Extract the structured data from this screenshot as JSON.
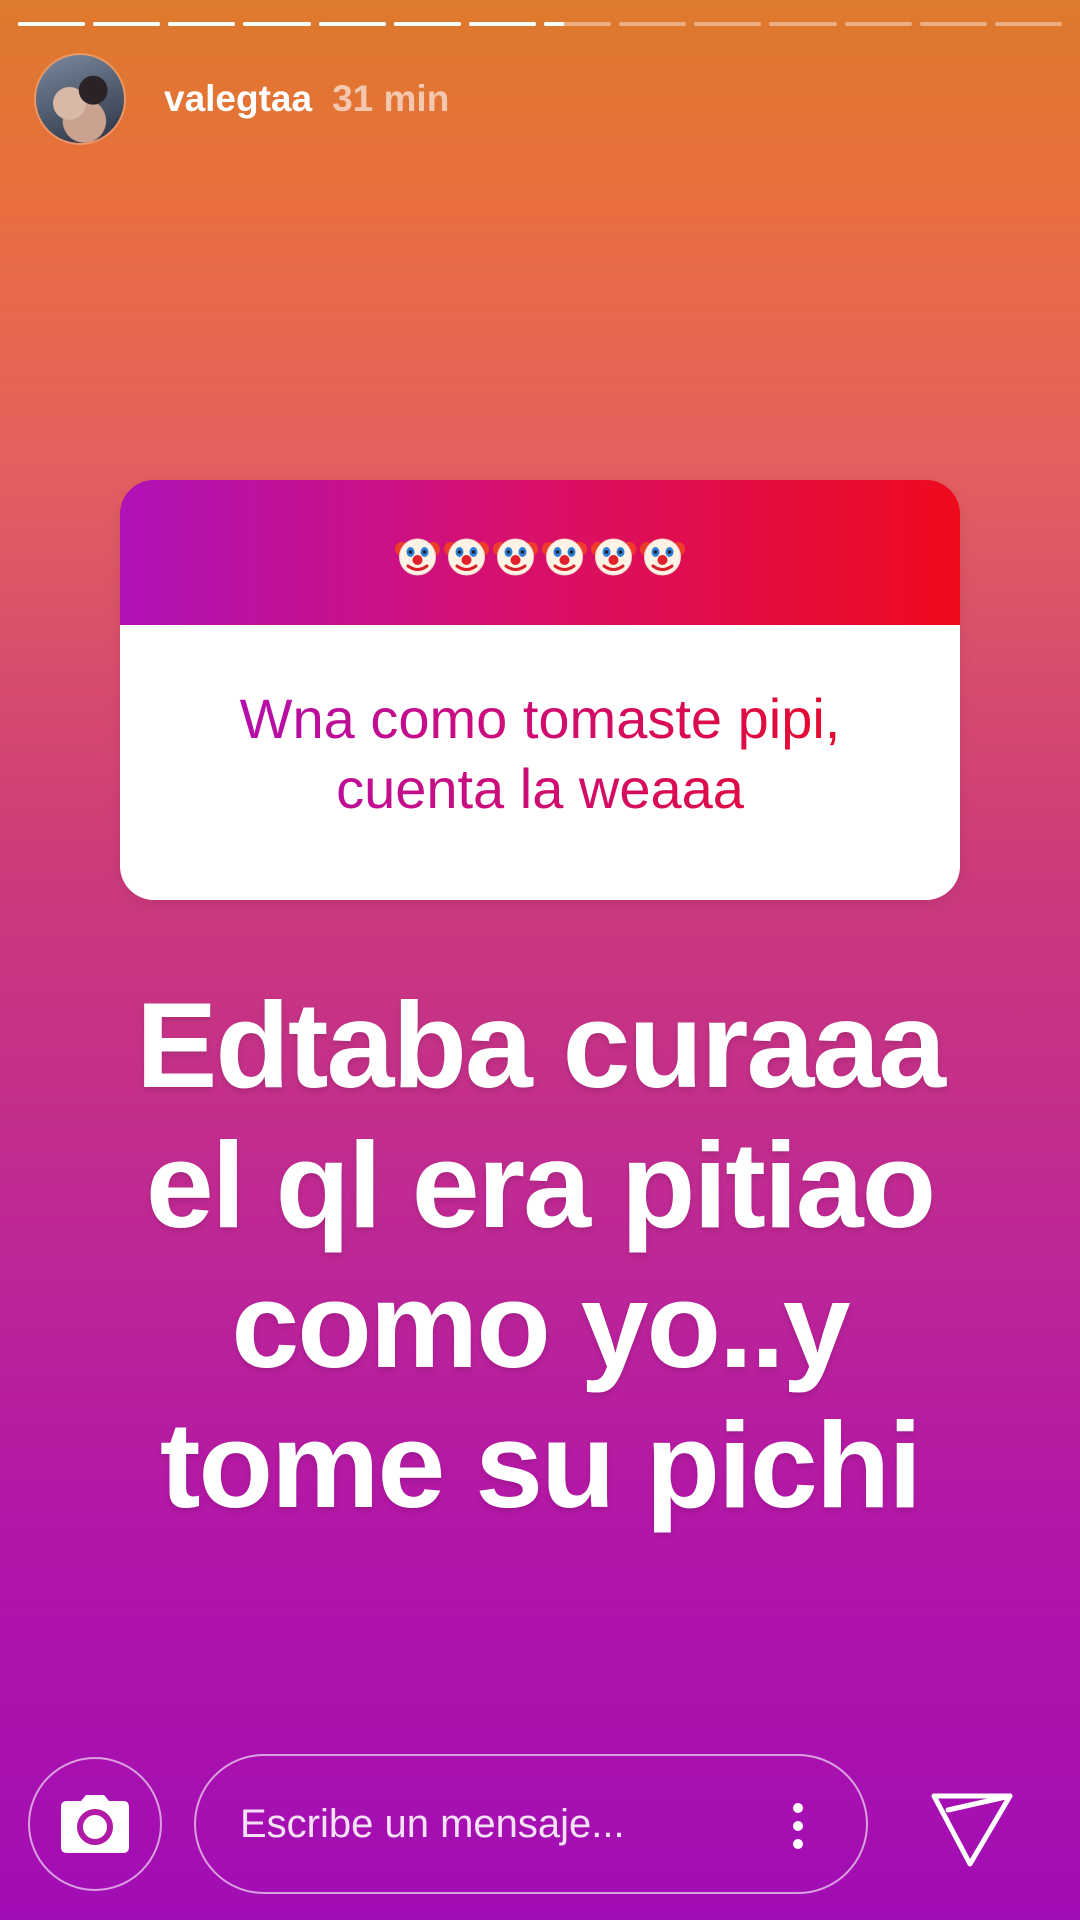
{
  "story": {
    "progress": {
      "segments": [
        1,
        1,
        1,
        1,
        1,
        1,
        1,
        0.3,
        0,
        0,
        0,
        0,
        0,
        0
      ]
    },
    "user": {
      "username": "valegtaa",
      "time_ago": "31 min"
    },
    "question_sticker": {
      "header_icon": "clown-face-emoji",
      "header_emoji_count": 6,
      "question": "Wna como tomaste pipi, cuenta la weaaa",
      "gradient_colors": [
        "#b012b8",
        "#d61070",
        "#ef0a1c"
      ]
    },
    "answer": "Edtaba curaaa el ql era pitiao como yo..y tome su pichi"
  },
  "composer": {
    "camera_icon": "camera-icon",
    "placeholder": "Escribe un mensaje...",
    "more_icon": "more-vertical-icon",
    "send_icon": "send-icon"
  },
  "colors": {
    "background_top": "#dd7a2c",
    "background_bottom": "#a10db5",
    "text": "#ffffff"
  }
}
